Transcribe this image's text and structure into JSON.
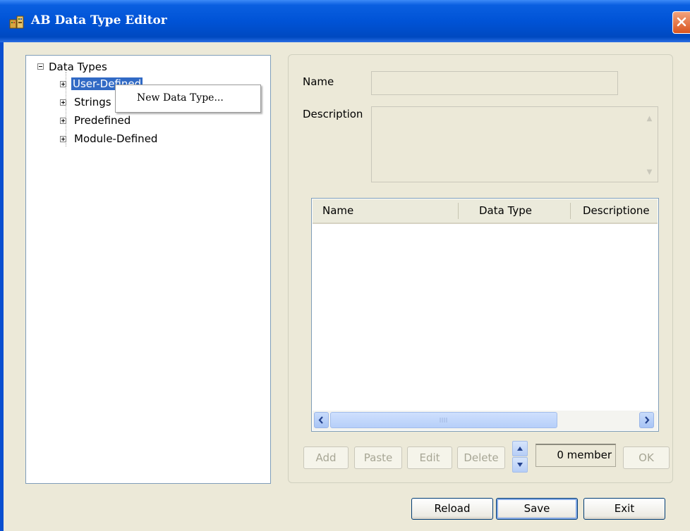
{
  "window": {
    "title": "AB Data Type Editor"
  },
  "tree": {
    "root": "Data Types",
    "items": [
      {
        "label": "User-Defined",
        "selected": true
      },
      {
        "label": "Strings"
      },
      {
        "label": "Predefined"
      },
      {
        "label": "Module-Defined"
      }
    ]
  },
  "context_menu": {
    "items": [
      "New Data Type..."
    ]
  },
  "form": {
    "name_label": "Name",
    "name_value": "",
    "description_label": "Description",
    "description_value": ""
  },
  "grid": {
    "columns": [
      "Name",
      "Data Type",
      "Descriptione"
    ],
    "rows": []
  },
  "member_buttons": {
    "add": "Add",
    "paste": "Paste",
    "edit": "Edit",
    "delete": "Delete",
    "ok": "OK"
  },
  "member_count": "0 member",
  "footer": {
    "reload": "Reload",
    "save": "Save",
    "exit": "Exit"
  },
  "icons": {
    "window": "data-type-app-icon",
    "close": "close-icon"
  },
  "colors": {
    "titlebar": "#0053d6",
    "selection": "#316ac5",
    "close": "#d9541f"
  }
}
